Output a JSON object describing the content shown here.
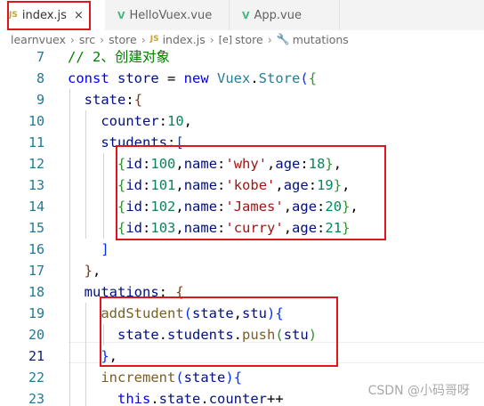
{
  "tabs": [
    {
      "badge": "JS",
      "label": "index.js",
      "close": "×",
      "active": true
    },
    {
      "badge": "V",
      "label": "HelloVuex.vue"
    },
    {
      "badge": "V",
      "label": "App.vue"
    }
  ],
  "breadcrumb": {
    "items": [
      "learnvuex",
      "src",
      "store",
      "index.js",
      "store",
      "mutations"
    ],
    "separator": "›",
    "file_badge": "JS",
    "module_badge": "[e]",
    "wrench_glyph": "🔧"
  },
  "editor": {
    "current_line": "21",
    "lines": [
      {
        "number": "7",
        "tokens": [
          [
            "c",
            "// 2、创建对象"
          ]
        ]
      },
      {
        "number": "8",
        "tokens": [
          [
            "k",
            "const "
          ],
          [
            "v",
            "store"
          ],
          [
            "p",
            " = "
          ],
          [
            "k",
            "new "
          ],
          [
            "t",
            "Vuex"
          ],
          [
            "p",
            "."
          ],
          [
            "t",
            "Store"
          ],
          [
            "b1",
            "("
          ],
          [
            "b2",
            "{"
          ]
        ]
      },
      {
        "number": "9",
        "tokens": [
          [
            "p",
            "  "
          ],
          [
            "v",
            "state"
          ],
          [
            "p",
            ":"
          ],
          [
            "b3",
            "{"
          ]
        ]
      },
      {
        "number": "10",
        "tokens": [
          [
            "p",
            "    "
          ],
          [
            "v",
            "counter"
          ],
          [
            "p",
            ":"
          ],
          [
            "n",
            "10"
          ],
          [
            "p",
            ","
          ]
        ]
      },
      {
        "number": "11",
        "tokens": [
          [
            "p",
            "    "
          ],
          [
            "v",
            "students"
          ],
          [
            "p",
            ":"
          ],
          [
            "b1",
            "["
          ]
        ]
      },
      {
        "number": "12",
        "tokens": [
          [
            "p",
            "      "
          ],
          [
            "b2",
            "{"
          ],
          [
            "v",
            "id"
          ],
          [
            "p",
            ":"
          ],
          [
            "n",
            "100"
          ],
          [
            "p",
            ","
          ],
          [
            "v",
            "name"
          ],
          [
            "p",
            ":"
          ],
          [
            "s",
            "'why'"
          ],
          [
            "p",
            ","
          ],
          [
            "v",
            "age"
          ],
          [
            "p",
            ":"
          ],
          [
            "n",
            "18"
          ],
          [
            "b2",
            "}"
          ],
          [
            "p",
            ","
          ]
        ]
      },
      {
        "number": "13",
        "tokens": [
          [
            "p",
            "      "
          ],
          [
            "b2",
            "{"
          ],
          [
            "v",
            "id"
          ],
          [
            "p",
            ":"
          ],
          [
            "n",
            "101"
          ],
          [
            "p",
            ","
          ],
          [
            "v",
            "name"
          ],
          [
            "p",
            ":"
          ],
          [
            "s",
            "'kobe'"
          ],
          [
            "p",
            ","
          ],
          [
            "v",
            "age"
          ],
          [
            "p",
            ":"
          ],
          [
            "n",
            "19"
          ],
          [
            "b2",
            "}"
          ],
          [
            "p",
            ","
          ]
        ]
      },
      {
        "number": "14",
        "tokens": [
          [
            "p",
            "      "
          ],
          [
            "b2",
            "{"
          ],
          [
            "v",
            "id"
          ],
          [
            "p",
            ":"
          ],
          [
            "n",
            "102"
          ],
          [
            "p",
            ","
          ],
          [
            "v",
            "name"
          ],
          [
            "p",
            ":"
          ],
          [
            "s",
            "'James'"
          ],
          [
            "p",
            ","
          ],
          [
            "v",
            "age"
          ],
          [
            "p",
            ":"
          ],
          [
            "n",
            "20"
          ],
          [
            "b2",
            "}"
          ],
          [
            "p",
            ","
          ]
        ]
      },
      {
        "number": "15",
        "tokens": [
          [
            "p",
            "      "
          ],
          [
            "b2",
            "{"
          ],
          [
            "v",
            "id"
          ],
          [
            "p",
            ":"
          ],
          [
            "n",
            "103"
          ],
          [
            "p",
            ","
          ],
          [
            "v",
            "name"
          ],
          [
            "p",
            ":"
          ],
          [
            "s",
            "'curry'"
          ],
          [
            "p",
            ","
          ],
          [
            "v",
            "age"
          ],
          [
            "p",
            ":"
          ],
          [
            "n",
            "21"
          ],
          [
            "b2",
            "}"
          ]
        ]
      },
      {
        "number": "16",
        "tokens": [
          [
            "p",
            "    "
          ],
          [
            "b1",
            "]"
          ]
        ]
      },
      {
        "number": "17",
        "tokens": [
          [
            "p",
            "  "
          ],
          [
            "b3",
            "}"
          ],
          [
            "p",
            ","
          ]
        ]
      },
      {
        "number": "18",
        "tokens": [
          [
            "p",
            "  "
          ],
          [
            "v",
            "mutations"
          ],
          [
            "p",
            ": "
          ],
          [
            "b3",
            "{"
          ]
        ]
      },
      {
        "number": "19",
        "tokens": [
          [
            "p",
            "    "
          ],
          [
            "f",
            "addStudent"
          ],
          [
            "b1",
            "("
          ],
          [
            "v",
            "state"
          ],
          [
            "p",
            ","
          ],
          [
            "v",
            "stu"
          ],
          [
            "b1",
            ")"
          ],
          [
            "b1",
            "{"
          ]
        ]
      },
      {
        "number": "20",
        "tokens": [
          [
            "p",
            "      "
          ],
          [
            "v",
            "state"
          ],
          [
            "p",
            "."
          ],
          [
            "v",
            "students"
          ],
          [
            "p",
            "."
          ],
          [
            "f",
            "push"
          ],
          [
            "b2",
            "("
          ],
          [
            "v",
            "stu"
          ],
          [
            "b2",
            ")"
          ]
        ]
      },
      {
        "number": "21",
        "tokens": [
          [
            "p",
            "    "
          ],
          [
            "b1",
            "}"
          ],
          [
            "p",
            ","
          ]
        ]
      },
      {
        "number": "22",
        "tokens": [
          [
            "p",
            "    "
          ],
          [
            "f",
            "increment"
          ],
          [
            "b1",
            "("
          ],
          [
            "v",
            "state"
          ],
          [
            "b1",
            ")"
          ],
          [
            "b1",
            "{"
          ]
        ]
      },
      {
        "number": "23",
        "tokens": [
          [
            "p",
            "      "
          ],
          [
            "k",
            "this"
          ],
          [
            "p",
            "."
          ],
          [
            "v",
            "state"
          ],
          [
            "p",
            "."
          ],
          [
            "v",
            "counter"
          ],
          [
            "p",
            "++"
          ]
        ]
      }
    ]
  },
  "watermark": "CSDN @小码哥呀",
  "colors": {
    "keyword": "#0000ff",
    "variable": "#001080",
    "number": "#098658",
    "string": "#a31515",
    "function": "#795e26",
    "type": "#267f99",
    "comment": "#008000",
    "annotation_box": "#e0151e",
    "line_number": "#237893"
  }
}
